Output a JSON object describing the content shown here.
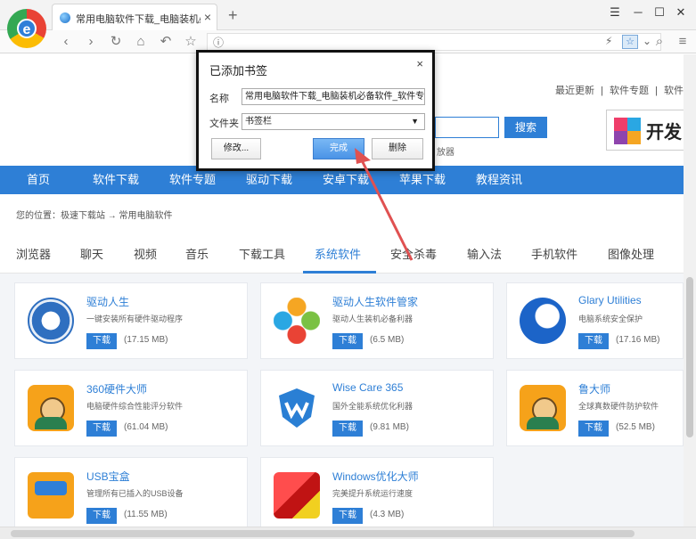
{
  "browser": {
    "tab_title": "常用电脑软件下载_电脑装机必备",
    "tab_close": "×",
    "new_tab": "+",
    "window_controls": [
      "☰",
      "─",
      "☐",
      "✕"
    ],
    "nav": [
      "‹",
      "›",
      "↻",
      "⌂",
      "↶",
      "☆"
    ],
    "logo_letter": "e"
  },
  "dialog": {
    "title": "已添加书签",
    "close": "×",
    "name_label": "名称",
    "name_value": "常用电脑软件下载_电脑装机必备软件_软件专",
    "folder_label": "文件夹",
    "folder_value": "书签栏",
    "modify_button": "修改...",
    "done_button": "完成",
    "delete_button": "删除"
  },
  "header": {
    "top_links": [
      "最近更新",
      "|",
      "软件专题",
      "|",
      "软件"
    ],
    "search_button": "搜索",
    "players": "放器",
    "brand_text": "开发"
  },
  "mainnav": [
    "首页",
    "软件下载",
    "软件专题",
    "驱动下载",
    "安卓下载",
    "苹果下载",
    "教程资讯"
  ],
  "breadcrumb": "您的位置：极速下载站 → 常用电脑软件",
  "categories": [
    "浏览器",
    "聊天",
    "视频",
    "音乐",
    "下载工具",
    "系统软件",
    "安全杀毒",
    "输入法",
    "手机软件",
    "图像处理"
  ],
  "active_category": "系统软件",
  "download_label": "下载",
  "cards": [
    {
      "name": "驱动人生",
      "desc": "一键安装所有硬件驱动程序",
      "size": "(17.15 MB)",
      "icon": "gear-icon"
    },
    {
      "name": "驱动人生软件管家",
      "desc": "驱动人生装机必备利器",
      "size": "(6.5 MB)",
      "icon": "flower-icon"
    },
    {
      "name": "Glary Utilities",
      "desc": "电脑系统安全保护",
      "size": "(17.16 MB)",
      "icon": "glary-icon"
    },
    {
      "name": "360硬件大师",
      "desc": "电脑硬件综合性能评分软件",
      "size": "(61.04 MB)",
      "icon": "face-icon"
    },
    {
      "name": "Wise Care 365",
      "desc": "国外全能系统优化利器",
      "size": "(9.81 MB)",
      "icon": "shield-icon"
    },
    {
      "name": "鲁大师",
      "desc": "全球真数硬件防护软件",
      "size": "(52.5 MB)",
      "icon": "face-icon"
    },
    {
      "name": "USB宝盒",
      "desc": "管理所有已插入的USB设备",
      "size": "(11.55 MB)",
      "icon": "usb-icon"
    },
    {
      "name": "Windows优化大师",
      "desc": "完美提升系统运行速度",
      "size": "(4.3 MB)",
      "icon": "cube-icon"
    }
  ],
  "colors": {
    "accent": "#2e7fd6",
    "arrow": "#e05151"
  }
}
